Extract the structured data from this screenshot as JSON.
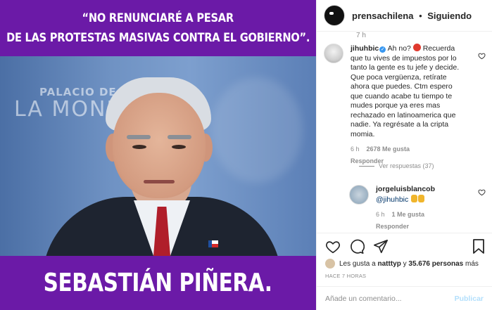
{
  "post_image": {
    "headline_line1": "“NO RENUNCIARÉ A PESAR",
    "headline_line2": "DE LAS PROTESTAS MASIVAS CONTRA EL GOBIERNO”.",
    "backdrop_line1": "PALACIO DE",
    "backdrop_line2": "LA MONE",
    "caption_name": "SEBASTIÁN PIÑERA.",
    "band_color": "#6b1aa7"
  },
  "header": {
    "username": "prensachilena",
    "separator": "•",
    "follow_status": "Siguiendo"
  },
  "comments": {
    "prev_time": "7 h",
    "items": [
      {
        "username": "jihuhbic",
        "verified_icon": "verified-badge",
        "text_before_emoji": "Ah no? ",
        "text_after_emoji": " Recuerda que tu vives de impuestos por lo tanto la gente es tu jefe y decide. Que poca vergüenza, retírate ahora que puedes. Ctm espero que cuando acabe tu tiempo te mudes porque ya eres mas rechazado en latinoamerica que nadie. Ya regrésate a la cripta momia.",
        "time": "6 h",
        "likes": "2678 Me gusta",
        "reply_label": "Responder",
        "view_replies": "Ver respuestas (37)"
      },
      {
        "username": "jorgeluisblancob",
        "mention": "@jihuhbic",
        "time": "6 h",
        "likes": "1 Me gusta",
        "reply_label": "Responder"
      }
    ]
  },
  "actions": {
    "icons": [
      "heart-icon",
      "comment-icon",
      "share-icon",
      "bookmark-icon"
    ],
    "likes_prefix": "Les gusta a ",
    "likes_user": "natttyp",
    "likes_middle": " y ",
    "likes_count": "35.676 personas",
    "likes_suffix": " más",
    "time_ago": "HACE 7 HORAS"
  },
  "add_comment": {
    "placeholder": "Añade un comentario...",
    "publish_label": "Publicar"
  }
}
